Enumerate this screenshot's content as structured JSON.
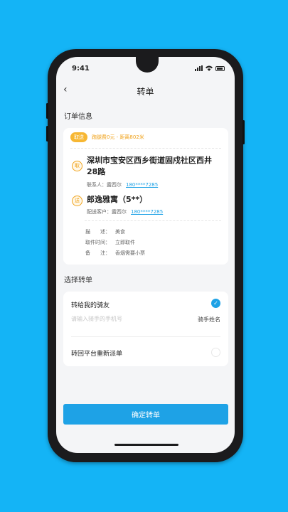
{
  "status_bar": {
    "time": "9:41"
  },
  "nav": {
    "back": "‹",
    "title": "转单"
  },
  "order_section": {
    "title": "订单信息",
    "pickup_tag": "取送",
    "distance_text": "跑腿费0元 - 距离802米",
    "pickup": {
      "badge": "取",
      "address": "深圳市宝安区西乡街道固戍社区西井28路",
      "contact_label": "联系人：露西尔",
      "contact_phone": "180****7285"
    },
    "delivery": {
      "badge": "送",
      "address": "郎逸雅寓（5**）",
      "contact_label": "配送客户：露西尔",
      "contact_phone": "180****7285"
    },
    "details": [
      {
        "key": "描　　述：",
        "value": "美食"
      },
      {
        "key": "取件时间：",
        "value": "立即取件"
      },
      {
        "key": "备　　注：",
        "value": "香烟需要小票"
      }
    ]
  },
  "transfer_section": {
    "title": "选择转单",
    "option_friend": "转给我的骑友",
    "rider_phone_placeholder": "请输入骑手的手机号",
    "rider_name": "骑手姓名",
    "option_platform": "转回平台重新派单"
  },
  "confirm_label": "确定转单",
  "colors": {
    "background": "#14b4f6",
    "accent": "#1ea2e6",
    "tag": "#f7b733"
  }
}
